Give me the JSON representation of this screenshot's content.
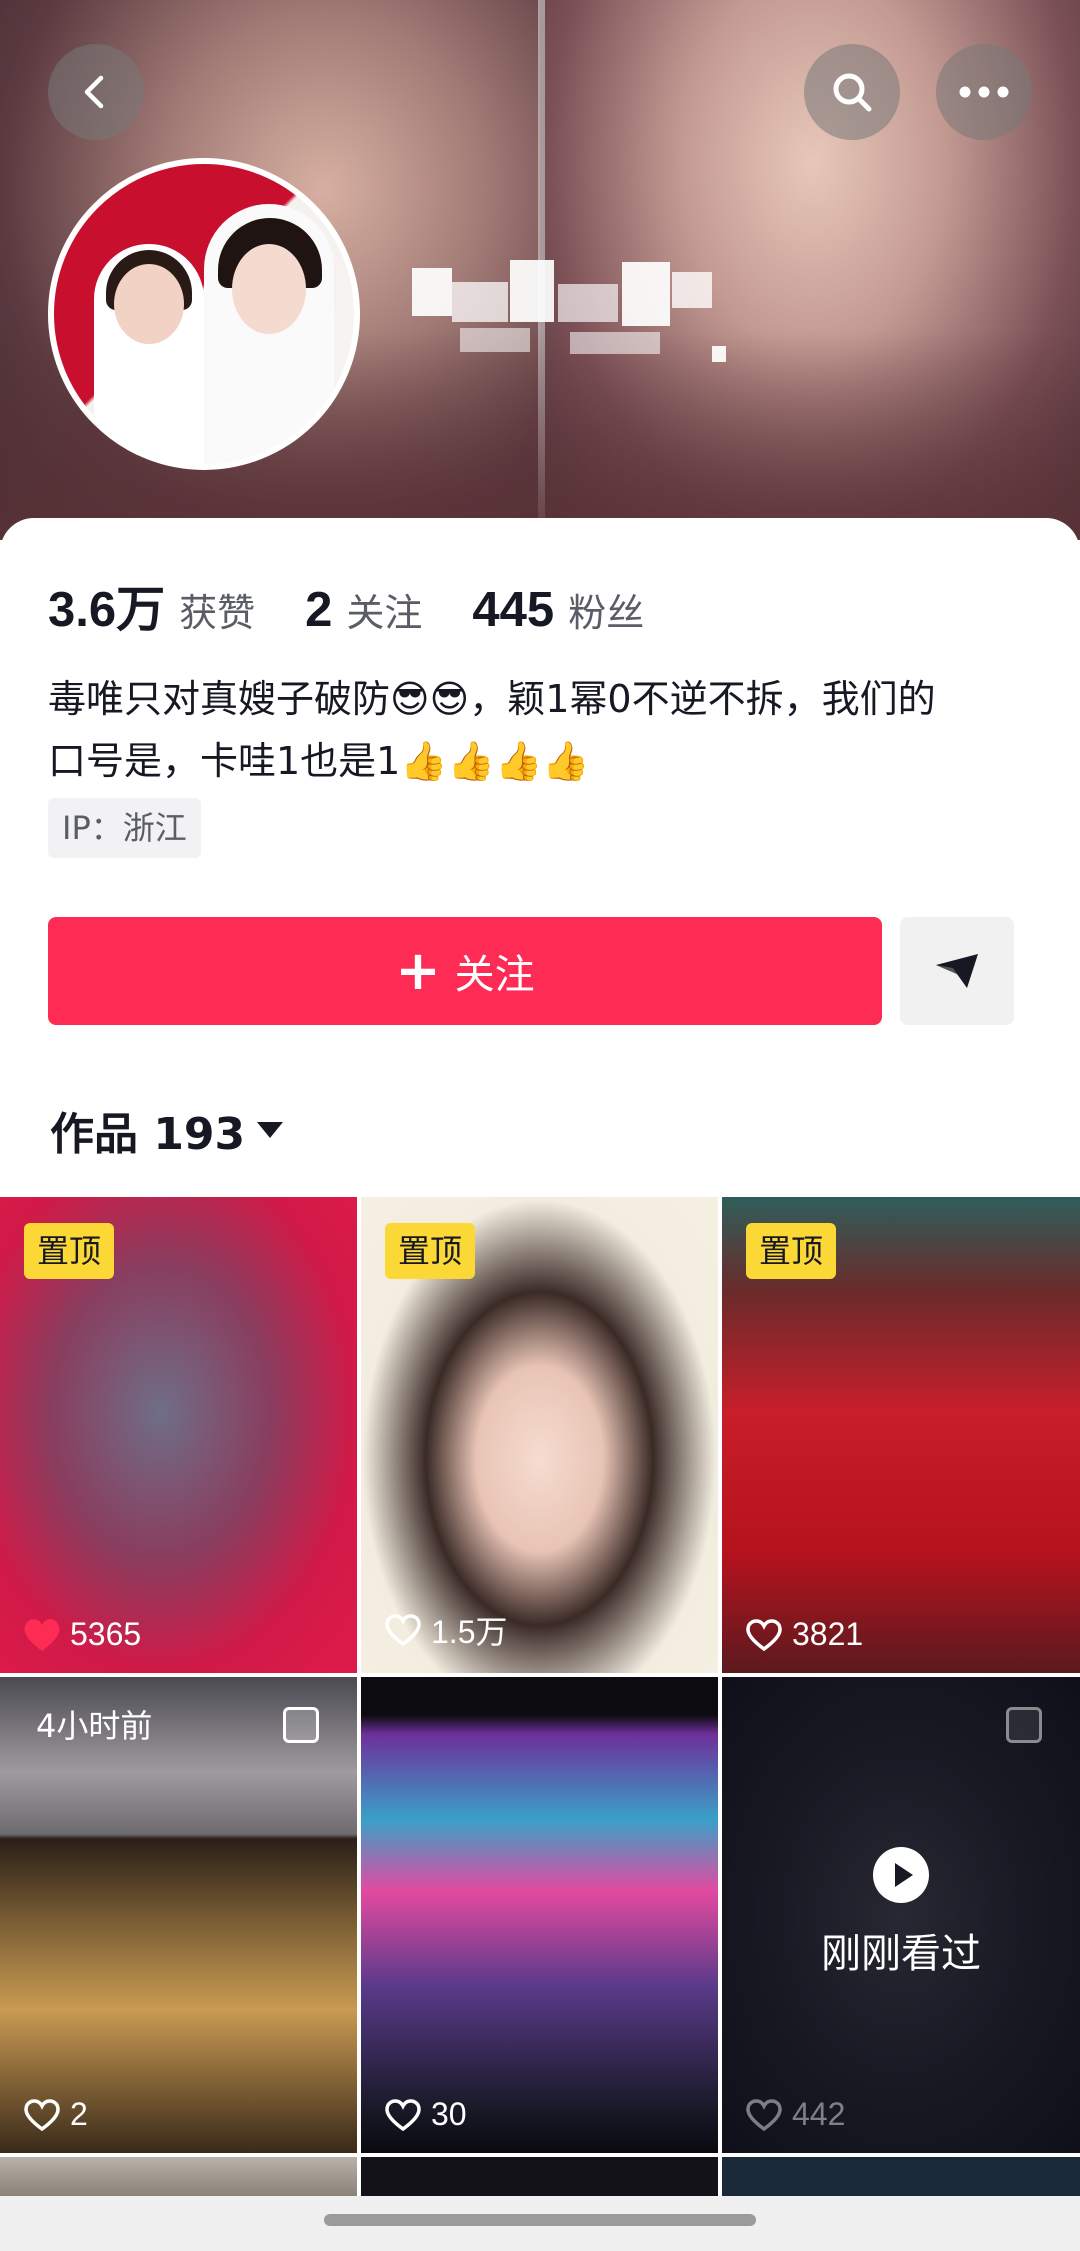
{
  "header": {
    "back_icon": "chevron-left-icon",
    "search_icon": "search-icon",
    "more_icon": "more-horizontal-icon"
  },
  "profile": {
    "stats": [
      {
        "value": "3.6万",
        "label": "获赞"
      },
      {
        "value": "2",
        "label": "关注"
      },
      {
        "value": "445",
        "label": "粉丝"
      }
    ],
    "bio_line1": "毒唯只对真嫂子破防😎😎，颖1幂0不逆不拆，我们的",
    "bio_line2": "口号是，卡哇1也是1👍👍👍👍",
    "ip": "IP：浙江"
  },
  "actions": {
    "follow_label": "关注",
    "follow_color": "#fe2c55",
    "share_icon": "send-icon"
  },
  "works": {
    "tab_label": "作品 193"
  },
  "grid": {
    "tiles": [
      {
        "pinned_label": "置顶",
        "likes": "5365",
        "liked": true
      },
      {
        "pinned_label": "置顶",
        "likes": "1.5万",
        "liked": false
      },
      {
        "pinned_label": "置顶",
        "likes": "3821",
        "liked": false
      },
      {
        "time": "4小时前",
        "likes": "2"
      },
      {
        "likes": "30"
      },
      {
        "watched_label": "刚刚看过",
        "likes": "442"
      }
    ]
  }
}
